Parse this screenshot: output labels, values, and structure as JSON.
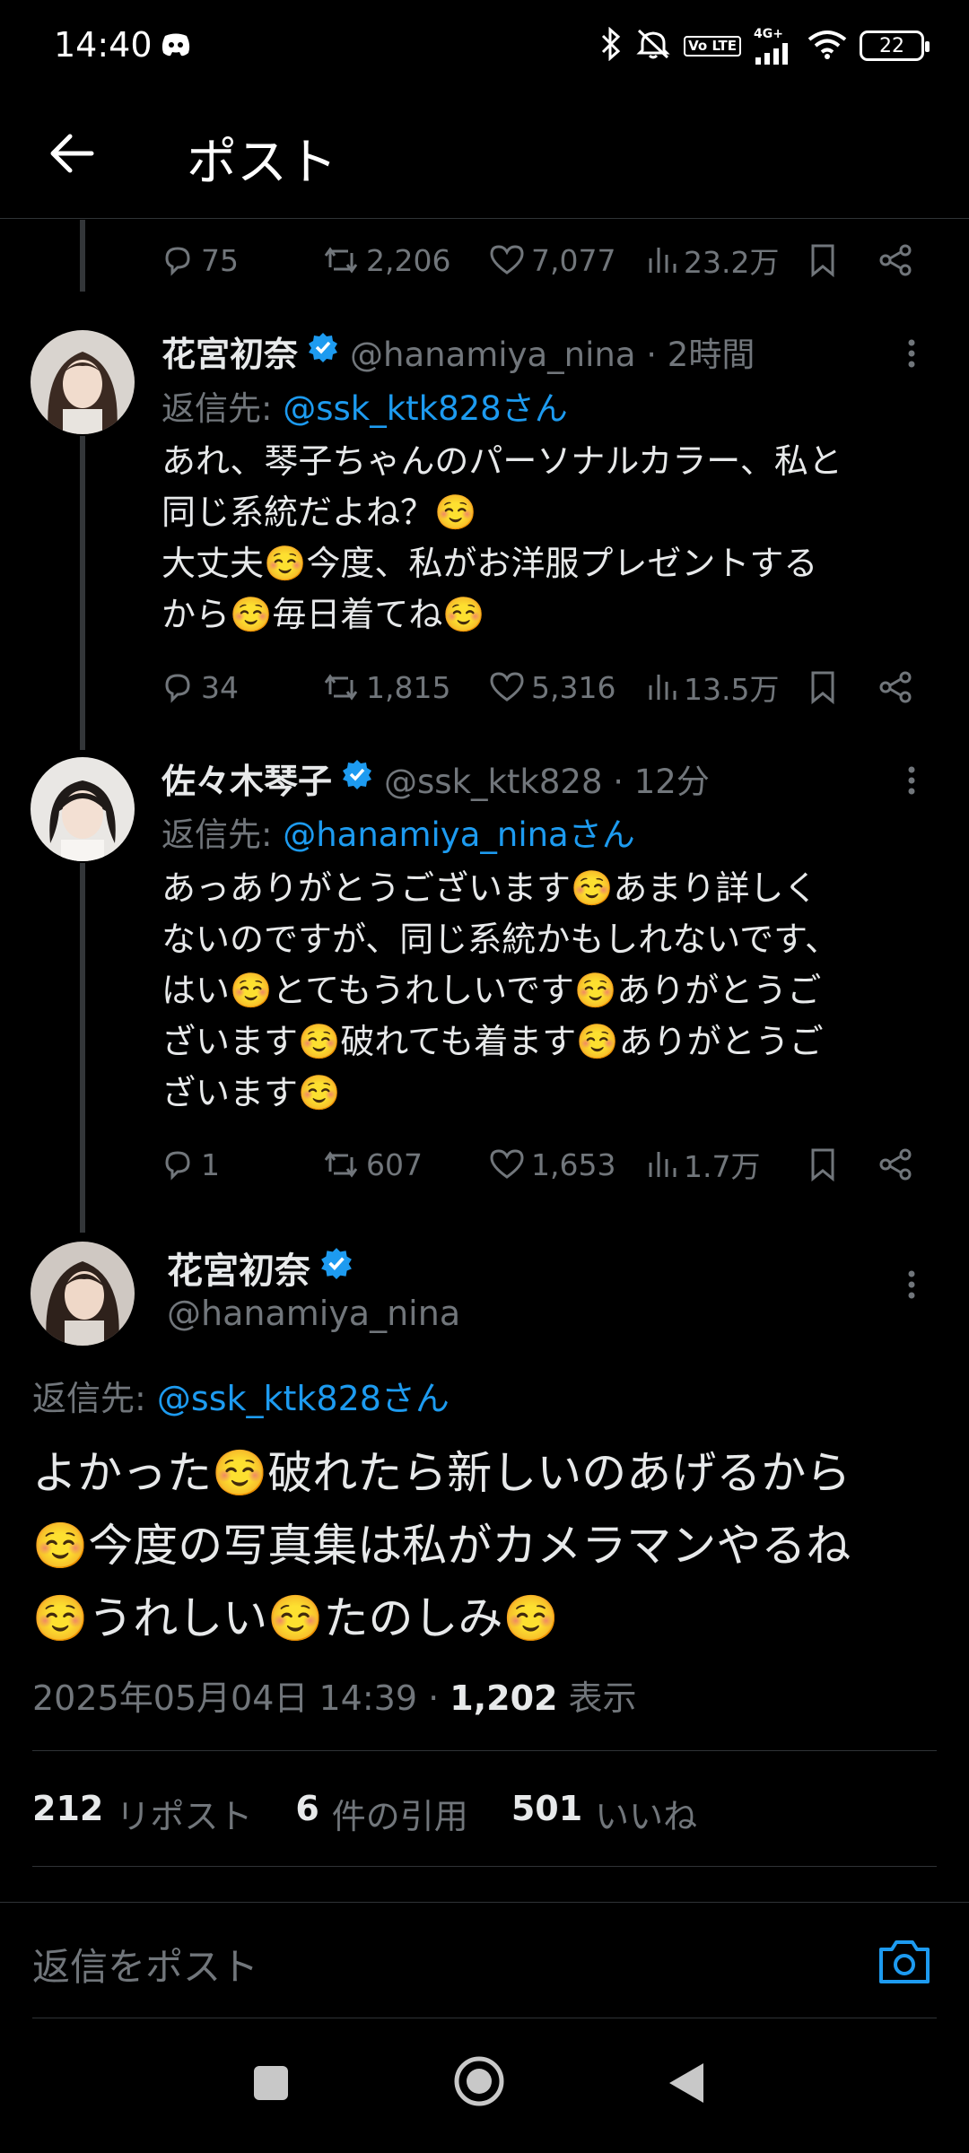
{
  "status_bar": {
    "time": "14:40",
    "network": "4G+",
    "volte": "Vo LTE",
    "battery": "22",
    "icons": [
      "discord-icon",
      "bluetooth-icon",
      "mute-icon",
      "volte-icon",
      "signal-icon",
      "wifi-icon",
      "battery-icon"
    ]
  },
  "header": {
    "title": "ポスト",
    "back_icon": "arrow-left-icon"
  },
  "top_actions": {
    "replies": "75",
    "reposts": "2,206",
    "likes": "7,077",
    "views": "23.2万"
  },
  "replies": [
    {
      "name": "花宮初奈",
      "handle": "@hanamiya_nina · 2時間",
      "reply_to_label": "返信先: ",
      "reply_to": "@ssk_ktk828さん",
      "body": "あれ、琴子ちゃんのパーソナルカラー、私と\n同じ系統だよね？☺️\n大丈夫☺️今度、私がお洋服プレゼントする\nから☺️毎日着てね☺️",
      "stats": {
        "replies": "34",
        "reposts": "1,815",
        "likes": "5,316",
        "views": "13.5万"
      }
    },
    {
      "name": "佐々木琴子",
      "handle": "@ssk_ktk828 · 12分",
      "reply_to_label": "返信先: ",
      "reply_to": "@hanamiya_ninaさん",
      "body": "あっありがとうございます☺️あまり詳しく\nないのですが、同じ系統かもしれないです、\nはい☺️とてもうれしいです☺️ありがとうご\nざいます☺️破れても着ます☺️ありがとうご\nざいます☺️",
      "stats": {
        "replies": "1",
        "reposts": "607",
        "likes": "1,653",
        "views": "1.7万"
      }
    }
  ],
  "main_tweet": {
    "name": "花宮初奈",
    "handle": "@hanamiya_nina",
    "reply_to_label": "返信先: ",
    "reply_to": "@ssk_ktk828さん",
    "body": "よかった☺️破れたら新しいのあげるから\n☺️今度の写真集は私がカメラマンやるね\n☺️うれしい☺️たのしみ☺️",
    "timestamp": "2025年05月04日 14:39 · ",
    "views_count": "1,202",
    "views_label": " 表示",
    "reposts_count": "212",
    "reposts_label": "リポスト",
    "quotes_count": "6",
    "quotes_label": "件の引用",
    "likes_count": "501",
    "likes_label": "いいね"
  },
  "reply_bar": {
    "placeholder": "返信をポスト",
    "camera_icon": "camera-icon"
  },
  "nav_bar": {
    "icons": [
      "recents-square-icon",
      "home-circle-icon",
      "back-triangle-icon"
    ]
  },
  "colors": {
    "background": "#000000",
    "text": "#e7e9ea",
    "muted": "#71767b",
    "accent": "#1d9bf0"
  }
}
